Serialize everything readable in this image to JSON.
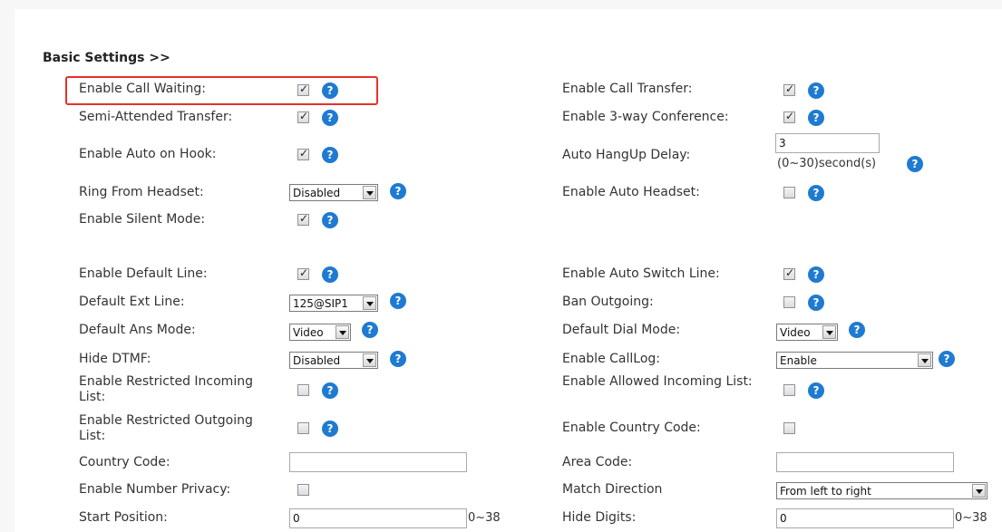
{
  "section": {
    "title": "Basic Settings >>"
  },
  "help_symbol": "?",
  "checkmark": "✓",
  "colors": {
    "highlight": "#e8312a",
    "help_icon": "#1f7ad1"
  },
  "left": {
    "call_waiting": {
      "label": "Enable Call Waiting:",
      "checked": true
    },
    "semi_attended": {
      "label": "Semi-Attended Transfer:",
      "checked": true
    },
    "auto_on_hook": {
      "label": "Enable Auto on Hook:",
      "checked": true
    },
    "ring_headset": {
      "label": "Ring From Headset:",
      "value": "Disabled"
    },
    "silent_mode": {
      "label": "Enable Silent Mode:",
      "checked": true
    },
    "default_line": {
      "label": "Enable Default Line:",
      "checked": true
    },
    "default_ext": {
      "label": "Default Ext Line:",
      "value": "125@SIP1"
    },
    "ans_mode": {
      "label": "Default Ans Mode:",
      "value": "Video"
    },
    "hide_dtmf": {
      "label": "Hide DTMF:",
      "value": "Disabled"
    },
    "restricted_incoming": {
      "label": "Enable Restricted Incoming List:",
      "checked": false
    },
    "restricted_outgoing": {
      "label": "Enable Restricted Outgoing List:",
      "checked": false
    },
    "country_code": {
      "label": "Country Code:",
      "value": ""
    },
    "number_privacy": {
      "label": "Enable Number Privacy:",
      "checked": false
    },
    "start_position": {
      "label": "Start Position:",
      "value": "0",
      "range": "0~38"
    }
  },
  "right": {
    "call_transfer": {
      "label": "Enable Call Transfer:",
      "checked": true
    },
    "three_way": {
      "label": "Enable 3-way Conference:",
      "checked": true
    },
    "hangup_delay": {
      "label": "Auto HangUp Delay:",
      "value": "3",
      "range": "(0~30)second(s)"
    },
    "auto_headset": {
      "label": "Enable Auto Headset:",
      "checked": false
    },
    "auto_switch": {
      "label": "Enable Auto Switch Line:",
      "checked": true
    },
    "ban_outgoing": {
      "label": "Ban Outgoing:",
      "checked": false
    },
    "dial_mode": {
      "label": "Default Dial Mode:",
      "value": "Video"
    },
    "calllog": {
      "label": "Enable CallLog:",
      "value": "Enable"
    },
    "allowed_incoming": {
      "label": "Enable Allowed Incoming List:",
      "checked": false
    },
    "country_code_enable": {
      "label": "Enable Country Code:",
      "checked": false
    },
    "area_code": {
      "label": "Area Code:",
      "value": ""
    },
    "match_direction": {
      "label": "Match Direction",
      "value": "From left to right"
    },
    "hide_digits": {
      "label": "Hide Digits:",
      "value": "0",
      "range": "0~38"
    }
  }
}
